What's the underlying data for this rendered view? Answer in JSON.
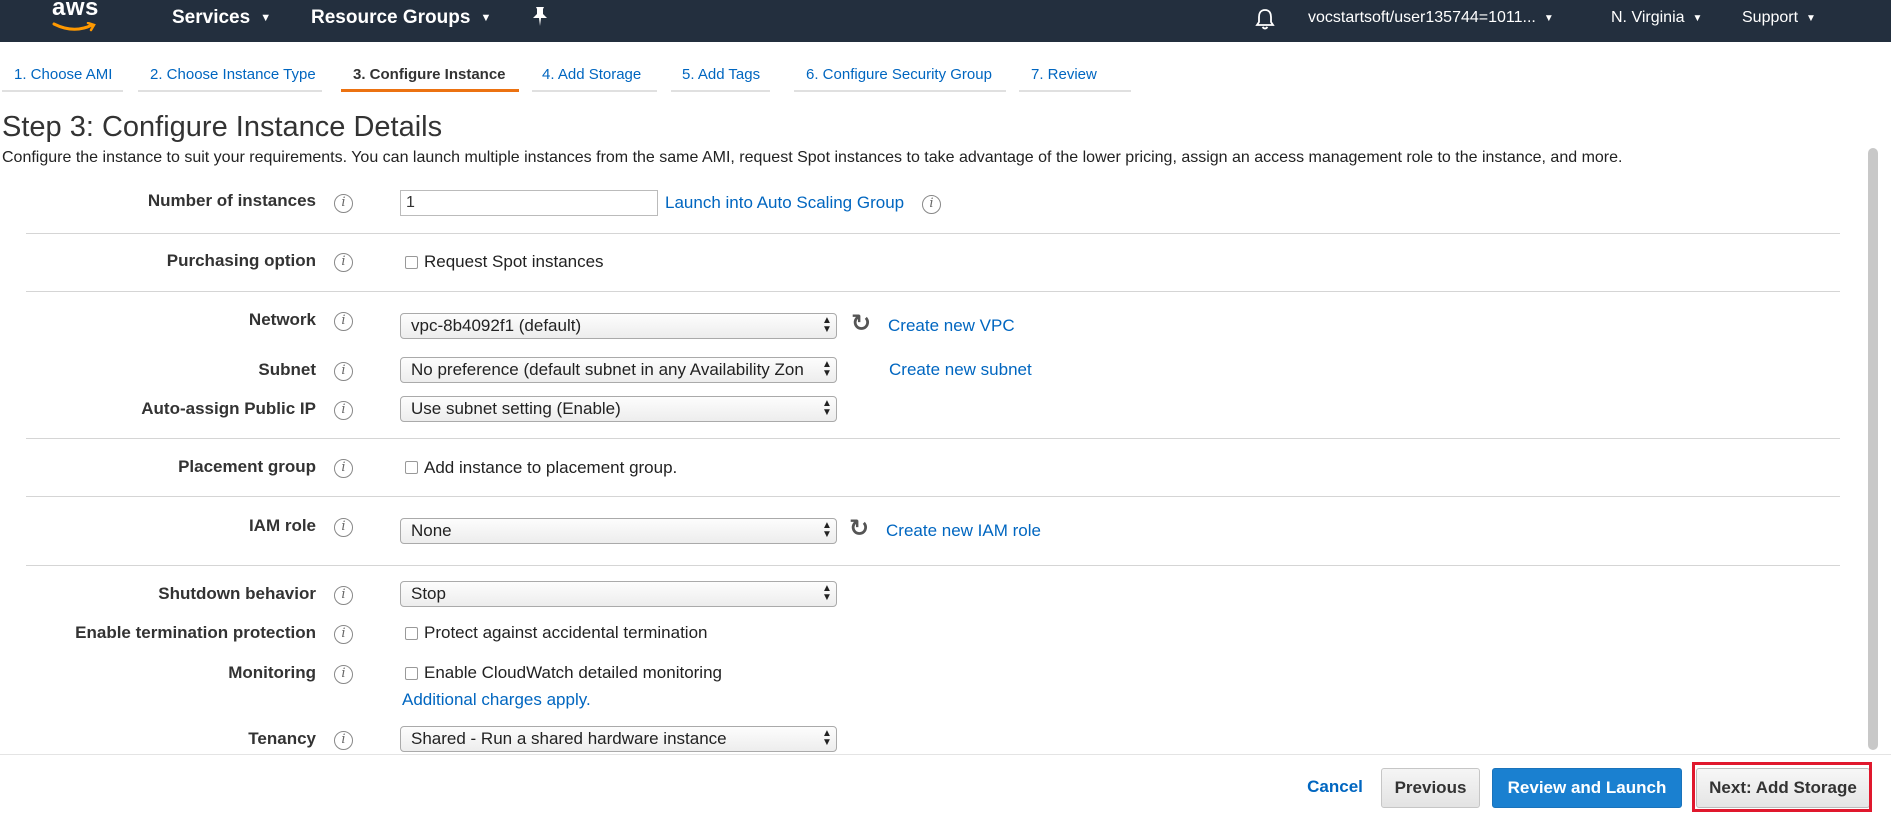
{
  "topbar": {
    "logo_text": "aws",
    "services": "Services",
    "resource_groups": "Resource Groups",
    "account": "vocstartsoft/user135744=1011...",
    "region": "N. Virginia",
    "support": "Support",
    "background_color": "#232f3e"
  },
  "tabs": [
    {
      "label": "1. Choose AMI"
    },
    {
      "label": "2. Choose Instance Type"
    },
    {
      "label": "3. Configure Instance"
    },
    {
      "label": "4. Add Storage"
    },
    {
      "label": "5. Add Tags"
    },
    {
      "label": "6. Configure Security Group"
    },
    {
      "label": "7. Review"
    }
  ],
  "active_tab_index": 2,
  "page": {
    "title": "Step 3: Configure Instance Details",
    "description": "Configure the instance to suit your requirements. You can launch multiple instances from the same AMI, request Spot instances to take advantage of the lower pricing, assign an access management role to the instance, and more."
  },
  "form": {
    "instances": {
      "label": "Number of instances",
      "value": "1",
      "link": "Launch into Auto Scaling Group"
    },
    "purchasing": {
      "label": "Purchasing option",
      "checkbox": "Request Spot instances",
      "checked": false
    },
    "network": {
      "label": "Network",
      "value": "vpc-8b4092f1 (default)",
      "link": "Create new VPC"
    },
    "subnet": {
      "label": "Subnet",
      "value": "No preference (default subnet in any Availability Zon",
      "link": "Create new subnet"
    },
    "public_ip": {
      "label": "Auto-assign Public IP",
      "value": "Use subnet setting (Enable)"
    },
    "placement": {
      "label": "Placement group",
      "checkbox": "Add instance to placement group.",
      "checked": false
    },
    "iam": {
      "label": "IAM role",
      "value": "None",
      "link": "Create new IAM role"
    },
    "shutdown": {
      "label": "Shutdown behavior",
      "value": "Stop"
    },
    "termination": {
      "label": "Enable termination protection",
      "checkbox": "Protect against accidental termination",
      "checked": false
    },
    "monitoring": {
      "label": "Monitoring",
      "checkbox": "Enable CloudWatch detailed monitoring",
      "checked": false,
      "note": "Additional charges apply."
    },
    "tenancy": {
      "label": "Tenancy",
      "value": "Shared - Run a shared hardware instance"
    }
  },
  "footer": {
    "cancel": "Cancel",
    "previous": "Previous",
    "review": "Review and Launch",
    "next": "Next: Add Storage",
    "primary_color": "#1a80d0",
    "highlight_color": "#e0182d"
  },
  "info_glyph": "i"
}
